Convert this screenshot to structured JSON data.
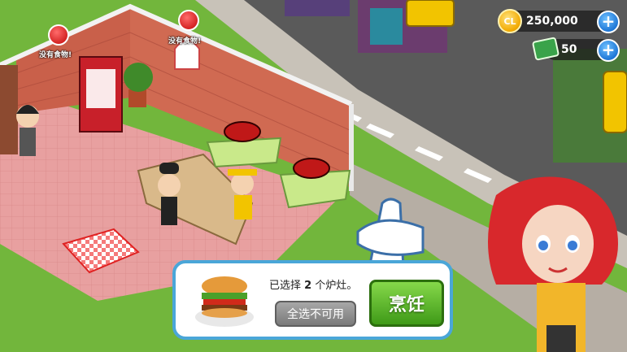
{
  "hud": {
    "coins": "250,000",
    "coin_symbol": "CL",
    "cash": "50",
    "plus": "+"
  },
  "alerts": [
    {
      "label": "没有食物!"
    },
    {
      "label": "没有食物!"
    }
  ],
  "panel": {
    "selected_prefix": "已选择 ",
    "selected_count": "2",
    "selected_suffix": " 个炉灶。",
    "deselect_button": "全选不可用",
    "cook_button": "烹饪"
  }
}
